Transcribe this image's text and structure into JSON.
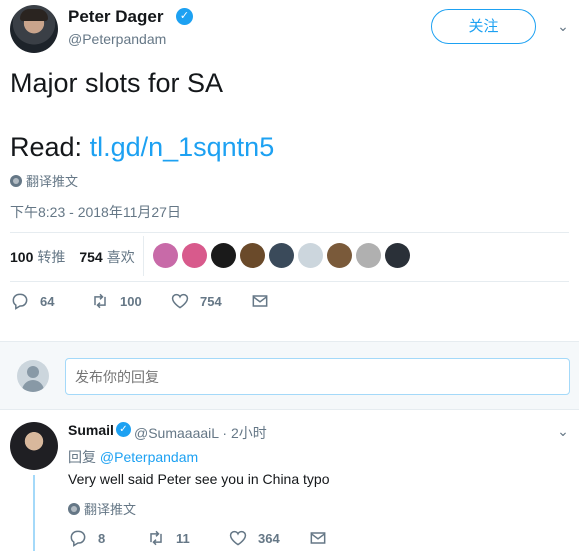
{
  "tweet": {
    "author_name": "Peter Dager",
    "author_handle": "@Peterpandam",
    "follow_label": "关注",
    "text_line1": "Major slots for SA",
    "read_prefix": "Read: ",
    "read_link": "tl.gd/n_1sqntn5",
    "translate_label": "翻译推文",
    "timestamp": "下午8:23 - 2018年11月27日",
    "stats": {
      "retweets_count": "100",
      "retweets_label": "转推",
      "likes_count": "754",
      "likes_label": "喜欢"
    },
    "likers": [
      "#c86aa8",
      "#d85a8c",
      "#1a1a1a",
      "#6a4a2a",
      "#3a4a5a",
      "#ccd6dd",
      "#7a5a3a",
      "#b0b0b0",
      "#2a3038"
    ],
    "actions": {
      "reply_count": "64",
      "retweet_count": "100",
      "like_count": "754"
    }
  },
  "reply_box": {
    "placeholder": "发布你的回复"
  },
  "reply": {
    "author_name": "Sumail",
    "author_handle": "@SumaaaaiL · 2小时",
    "reply_prefix": "回复 ",
    "reply_to": "@Peterpandam",
    "text": "Very well said Peter see you in China typo",
    "translate_label": "翻译推文",
    "actions": {
      "reply_count": "8",
      "retweet_count": "11",
      "like_count": "364"
    }
  },
  "colors": {
    "accent": "#1da1f2",
    "muted": "#657786",
    "text": "#14171a",
    "thread_line": "#a4d9f9"
  }
}
